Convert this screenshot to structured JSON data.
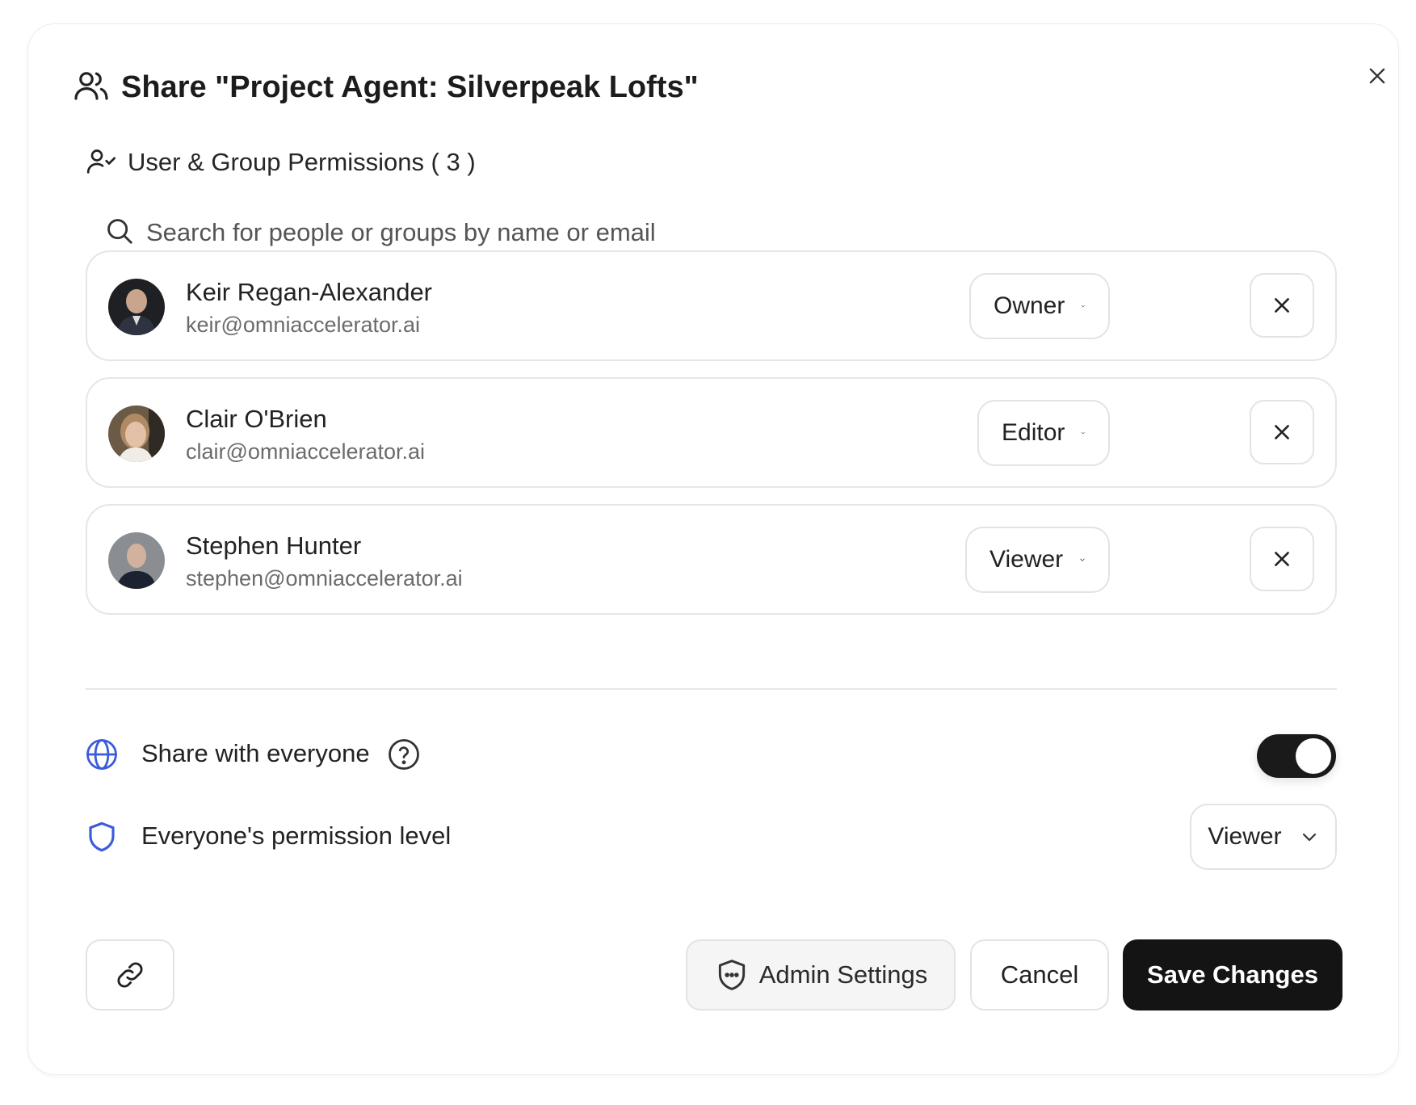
{
  "dialog": {
    "title": "Share \"Project Agent: Silverpeak Lofts\"",
    "close_label": "Close"
  },
  "permissions": {
    "section_title": "User & Group Permissions ( 3 )",
    "search_placeholder": "Search for people or groups by name or email",
    "users": [
      {
        "name": "Keir Regan-Alexander",
        "email": "keir@omniaccelerator.ai",
        "role": "Owner"
      },
      {
        "name": "Clair O'Brien",
        "email": "clair@omniaccelerator.ai",
        "role": "Editor"
      },
      {
        "name": "Stephen Hunter",
        "email": "stephen@omniaccelerator.ai",
        "role": "Viewer"
      }
    ]
  },
  "share_everyone": {
    "label": "Share with everyone",
    "enabled": true
  },
  "everyone_permission": {
    "label": "Everyone's permission level",
    "value": "Viewer"
  },
  "footer": {
    "admin_settings_label": "Admin Settings",
    "cancel_label": "Cancel",
    "save_label": "Save Changes"
  },
  "colors": {
    "accent_blue": "#3b5bdb",
    "primary_button": "#141414",
    "toggle_on": "#1a1a1a"
  },
  "icons": {
    "title": "users-icon",
    "section": "user-check-icon",
    "search": "search-icon",
    "share": "globe-icon",
    "help": "help-circle-icon",
    "permission": "shield-icon",
    "link": "link-icon",
    "admin": "shield-dots-icon",
    "close": "close-icon",
    "dropdown": "chevron-down-icon"
  }
}
